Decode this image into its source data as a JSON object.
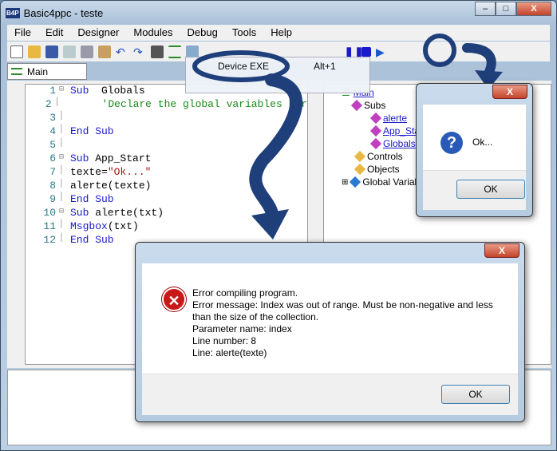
{
  "window": {
    "title": "Basic4ppc - teste",
    "logo": "B4P"
  },
  "menubar": [
    "File",
    "Edit",
    "Designer",
    "Modules",
    "Debug",
    "Tools",
    "Help"
  ],
  "module_combo": "Main",
  "compile_menu": {
    "item": "Device EXE",
    "shortcut": "Alt+1"
  },
  "code": [
    {
      "n": "1",
      "fold": true,
      "parts": [
        [
          "kw",
          "Sub"
        ],
        [
          "",
          "  Globals"
        ]
      ]
    },
    {
      "n": "2",
      "parts": [
        [
          "cm",
          "      'Declare the global variables her"
        ]
      ]
    },
    {
      "n": "3",
      "parts": []
    },
    {
      "n": "4",
      "parts": [
        [
          "kw",
          "End Sub"
        ]
      ]
    },
    {
      "n": "5",
      "parts": []
    },
    {
      "n": "6",
      "fold": true,
      "parts": [
        [
          "kw",
          "Sub"
        ],
        [
          "",
          " App_Start"
        ]
      ]
    },
    {
      "n": "7",
      "parts": [
        [
          "",
          "texte="
        ],
        [
          "st",
          "\"Ok...\""
        ]
      ]
    },
    {
      "n": "8",
      "parts": [
        [
          "",
          "alerte(texte)"
        ]
      ]
    },
    {
      "n": "9",
      "parts": [
        [
          "kw",
          "End Sub"
        ]
      ]
    },
    {
      "n": "10",
      "fold": true,
      "parts": [
        [
          "kw",
          "Sub"
        ],
        [
          "",
          " alerte(txt)"
        ]
      ]
    },
    {
      "n": "11",
      "parts": [
        [
          "kw",
          "Msgbox"
        ],
        [
          "",
          "(txt)"
        ]
      ]
    },
    {
      "n": "12",
      "parts": [
        [
          "kw",
          "End Sub"
        ]
      ]
    }
  ],
  "tree": {
    "root": "Main",
    "subs": "Subs",
    "sub_items": [
      "alerte",
      "App_Start",
      "Globals"
    ],
    "controls": "Controls",
    "objects": "Objects",
    "globals": "Global Variables"
  },
  "ok_dialog": {
    "message": "Ok...",
    "button": "OK",
    "icon": "question-icon"
  },
  "error_dialog": {
    "icon": "error-icon",
    "lines": [
      "Error compiling program.",
      "Error message: Index was out of range. Must be non-negative and less than the size of the collection.",
      "Parameter name: index",
      "Line number: 8",
      "Line: alerte(texte)"
    ],
    "button": "OK"
  }
}
